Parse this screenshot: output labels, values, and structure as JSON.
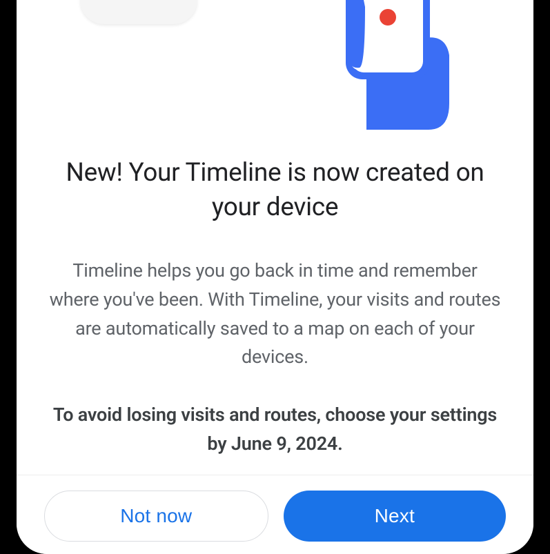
{
  "dialog": {
    "heading": "New! Your Timeline is now created on your device",
    "body": "Timeline helps you go back in time and remember where you've been.  With Timeline, your visits and routes are automatically saved to a map on each of your devices.",
    "warning": "To avoid losing visits and routes, choose your settings by June 9, 2024."
  },
  "buttons": {
    "secondary": "Not now",
    "primary": "Next"
  }
}
